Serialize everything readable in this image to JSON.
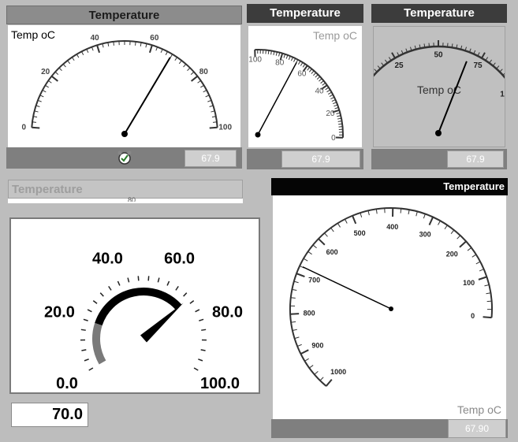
{
  "gauge1": {
    "title": "Temperature",
    "unit_label": "Temp oC",
    "ticks": [
      "0",
      "20",
      "40",
      "60",
      "80",
      "100"
    ],
    "value": 67.9,
    "readout": "67.9"
  },
  "gauge2": {
    "title": "Temperature",
    "unit_label": "Temp oC",
    "ticks": [
      "100",
      "80",
      "60",
      "40",
      "20",
      "0"
    ],
    "value": 67.9,
    "readout": "67.9"
  },
  "gauge3": {
    "title": "Temperature",
    "unit_label": "Temp oC",
    "ticks": [
      "0",
      "25",
      "50",
      "75",
      "100"
    ],
    "value": 67.9,
    "readout": "67.9"
  },
  "gauge4": {
    "title": "Temperature",
    "partial_tick": "80",
    "ticks": [
      "0.0",
      "20.0",
      "40.0",
      "60.0",
      "80.0",
      "100.0"
    ],
    "value": 70.0,
    "readout": "70.0"
  },
  "gauge5": {
    "title": "Temperature",
    "unit_label": "Temp oC",
    "ticks": [
      "1000",
      "900",
      "800",
      "700",
      "600",
      "500",
      "400",
      "300",
      "200",
      "100",
      "0"
    ],
    "value": 67.9,
    "readout": "67.90"
  },
  "colors": {
    "page_bg": "#bdbdbd",
    "header_gray": "#8c8c8c",
    "header_dark": "#3c3c3c",
    "footer_gray": "#7f7f7f",
    "face_white": "#ffffff",
    "face_gray": "#c0c0c0"
  },
  "icons": [
    "alarm-clock-icon"
  ]
}
